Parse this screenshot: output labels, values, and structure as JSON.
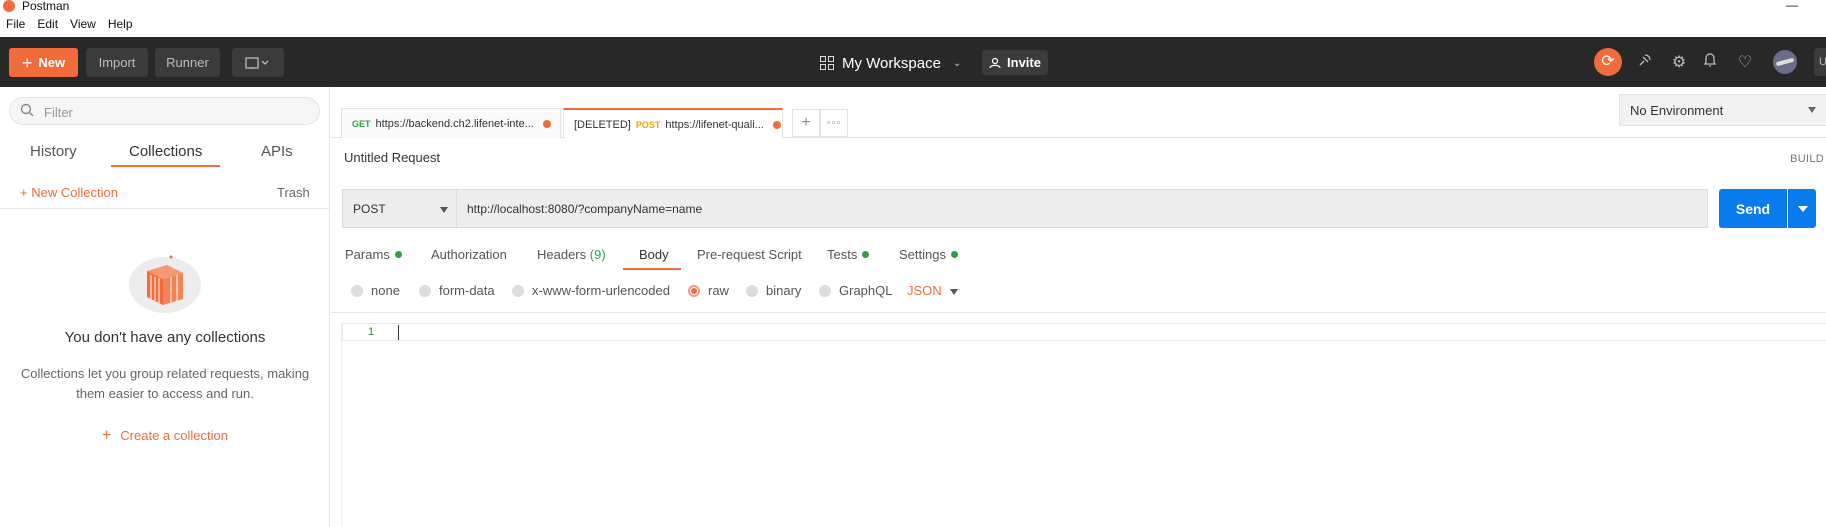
{
  "window": {
    "title": "Postman"
  },
  "menu": [
    "File",
    "Edit",
    "View",
    "Help"
  ],
  "header": {
    "new_label": "New",
    "import_label": "Import",
    "runner_label": "Runner",
    "workspace": "My Workspace",
    "invite_label": "Invite",
    "accent_color": "#f26b3a"
  },
  "sidebar": {
    "filter_placeholder": "Filter",
    "tabs": [
      "History",
      "Collections",
      "APIs"
    ],
    "active_tab": "Collections",
    "new_collection": "New Collection",
    "trash": "Trash",
    "empty_title": "You don't have any collections",
    "empty_desc": "Collections let you group related requests, making them easier to access and run.",
    "create_collection": "Create a collection"
  },
  "request_tabs": [
    {
      "method": "GET",
      "url": "https://backend.ch2.lifenet-inte...",
      "prefix": ""
    },
    {
      "method": "POST",
      "url": "https://lifenet-quali...",
      "prefix": "[DELETED]"
    }
  ],
  "environment": "No Environment",
  "request": {
    "title": "Untitled Request",
    "build_label": "BUILD",
    "method": "POST",
    "url": "http://localhost:8080/?companyName=name",
    "send_label": "Send"
  },
  "req_tabs": {
    "params": "Params",
    "authorization": "Authorization",
    "headers": "Headers",
    "headers_count": "(9)",
    "body": "Body",
    "prerequest": "Pre-request Script",
    "tests": "Tests",
    "settings": "Settings"
  },
  "body_options": {
    "none": "none",
    "form_data": "form-data",
    "urlencoded": "x-www-form-urlencoded",
    "raw": "raw",
    "binary": "binary",
    "graphql": "GraphQL",
    "format": "JSON",
    "selected": "raw"
  },
  "editor": {
    "line_number": "1"
  }
}
